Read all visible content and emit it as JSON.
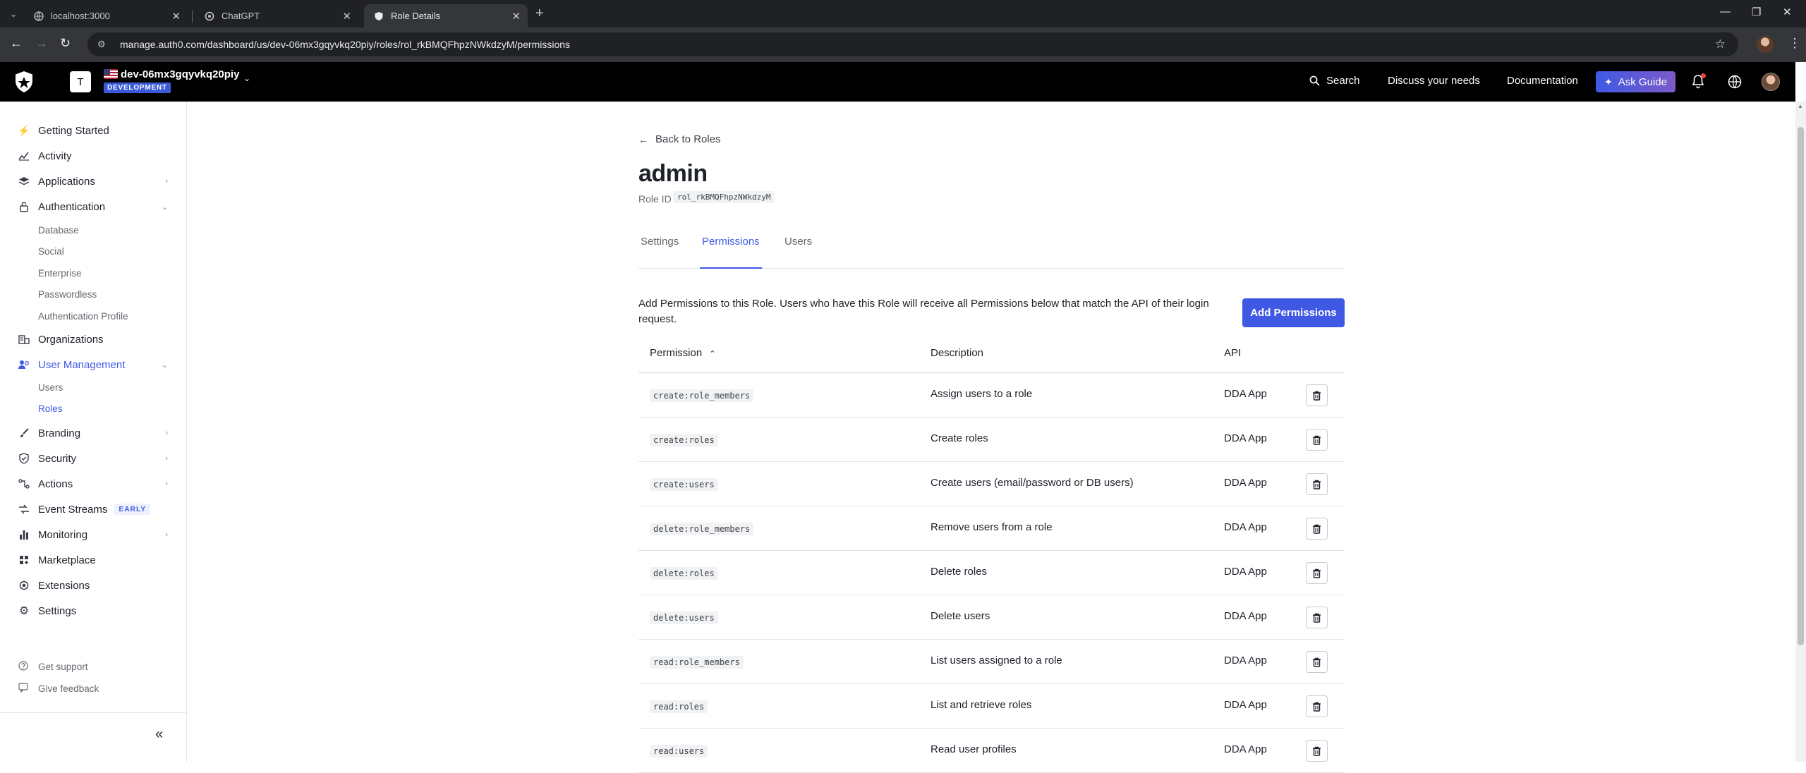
{
  "browser": {
    "tabs": [
      {
        "title": "localhost:3000",
        "active": false
      },
      {
        "title": "ChatGPT",
        "active": false
      },
      {
        "title": "Role Details",
        "active": true
      }
    ],
    "url": "manage.auth0.com/dashboard/us/dev-06mx3gqyvkq20piy/roles/rol_rkBMQFhpzNWkdzyM/permissions"
  },
  "header": {
    "tenant_initial": "T",
    "tenant_name": "dev-06mx3gqyvkq20piy",
    "tenant_env": "DEVELOPMENT",
    "search_label": "Search",
    "discuss_label": "Discuss your needs",
    "docs_label": "Documentation",
    "ask_guide_label": "Ask Guide"
  },
  "sidebar": {
    "getting_started": "Getting Started",
    "activity": "Activity",
    "applications": "Applications",
    "authentication": "Authentication",
    "auth_sub": [
      "Database",
      "Social",
      "Enterprise",
      "Passwordless",
      "Authentication Profile"
    ],
    "organizations": "Organizations",
    "user_management": "User Management",
    "um_sub": [
      "Users",
      "Roles"
    ],
    "branding": "Branding",
    "security": "Security",
    "actions": "Actions",
    "event_streams": "Event Streams",
    "event_streams_badge": "EARLY",
    "monitoring": "Monitoring",
    "marketplace": "Marketplace",
    "extensions": "Extensions",
    "settings": "Settings",
    "get_support": "Get support",
    "give_feedback": "Give feedback"
  },
  "main": {
    "back_label": "Back to Roles",
    "title": "admin",
    "role_id_label": "Role ID",
    "role_id": "rol_rkBMQFhpzNWkdzyM",
    "tabs": [
      "Settings",
      "Permissions",
      "Users"
    ],
    "intro": "Add Permissions to this Role. Users who have this Role will receive all Permissions below that match the API of their login request.",
    "add_button": "Add Permissions",
    "columns": {
      "permission": "Permission",
      "description": "Description",
      "api": "API"
    },
    "rows": [
      {
        "permission": "create:role_members",
        "description": "Assign users to a role",
        "api": "DDA App"
      },
      {
        "permission": "create:roles",
        "description": "Create roles",
        "api": "DDA App"
      },
      {
        "permission": "create:users",
        "description": "Create users (email/password or DB users)",
        "api": "DDA App"
      },
      {
        "permission": "delete:role_members",
        "description": "Remove users from a role",
        "api": "DDA App"
      },
      {
        "permission": "delete:roles",
        "description": "Delete roles",
        "api": "DDA App"
      },
      {
        "permission": "delete:users",
        "description": "Delete users",
        "api": "DDA App"
      },
      {
        "permission": "read:role_members",
        "description": "List users assigned to a role",
        "api": "DDA App"
      },
      {
        "permission": "read:roles",
        "description": "List and retrieve roles",
        "api": "DDA App"
      },
      {
        "permission": "read:users",
        "description": "Read user profiles",
        "api": "DDA App"
      }
    ]
  },
  "colors": {
    "accent": "#3f59e4",
    "header_bg": "#000000",
    "chrome_bg": "#202124"
  }
}
